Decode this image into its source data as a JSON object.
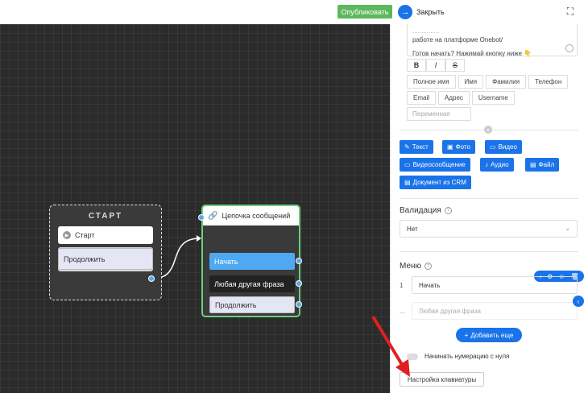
{
  "topbar": {
    "publish_label": "Опубликовать",
    "close_label": "Закрыть"
  },
  "canvas": {
    "start_node": {
      "title": "СТАРТ",
      "start_label": "Старт",
      "continue_label": "Продолжить"
    },
    "chain_node": {
      "title": "Цепочка сообщений",
      "items": [
        "Начать",
        "Любая другая фраза",
        "Продолжить"
      ]
    }
  },
  "panel": {
    "message_lines": [
      "...............",
      "работе на платформе Onebot/",
      "Готов начать? Нажимай кнопку ниже 👇"
    ],
    "format_buttons": [
      "B",
      "I",
      "S"
    ],
    "variables_row1": [
      "Полное имя",
      "Имя",
      "Фамилия",
      "Телефон"
    ],
    "variables_row2": [
      "Email",
      "Адрес",
      "Username"
    ],
    "variable_placeholder": "Переменная",
    "media_buttons": [
      "Текст",
      "Фото",
      "Видео",
      "Видеосообщение",
      "Аудио",
      "Файл",
      "Документ из CRM"
    ],
    "validation_label": "Валидация",
    "validation_value": "Нет",
    "menu_label": "Меню",
    "menu_items": [
      {
        "num": "1",
        "value": "Начать"
      },
      {
        "num": "...",
        "placeholder": "Любая другая фраза"
      }
    ],
    "add_more_label": "Добавить еще",
    "numbering_label": "Начинать нумерацию с нуля",
    "keyboard_button": "Настройка клавиатуры"
  },
  "colors": {
    "accent": "#1a73e8",
    "publish": "#5cb85c",
    "chain_border": "#6bcf7f"
  }
}
